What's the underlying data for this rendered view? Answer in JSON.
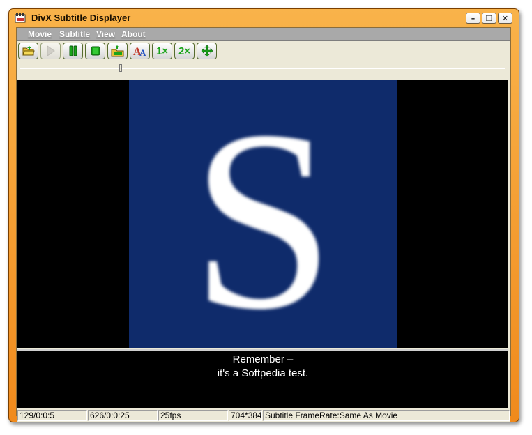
{
  "window": {
    "title": "DivX Subtitle Displayer",
    "controls": {
      "minimize": "–",
      "restore": "❐",
      "close": "✕"
    }
  },
  "menu": [
    "Movie",
    "Subtitle",
    "View",
    "About"
  ],
  "toolbar": {
    "buttons": [
      {
        "icon": "open-folder-icon"
      },
      {
        "icon": "play-icon",
        "disabled": true
      },
      {
        "icon": "pause-icon"
      },
      {
        "icon": "stop-icon"
      },
      {
        "icon": "load-subtitle-icon"
      },
      {
        "icon": "font-icon"
      },
      {
        "label": "1×",
        "icon": "zoom-1x-icon"
      },
      {
        "label": "2×",
        "icon": "zoom-2x-icon"
      },
      {
        "icon": "fullscreen-move-icon"
      }
    ]
  },
  "seek": {
    "progress": 0.206
  },
  "video": {
    "logo_letter": "S",
    "bg": "#0f2b6b"
  },
  "subtitle": {
    "lines": [
      "Remember –",
      "it's a Softpedia test."
    ]
  },
  "status": {
    "frames": "129/0:0:5",
    "total": "626/0:0:25",
    "fps": "25fps",
    "resolution": "704*384",
    "subtitle_rate": "Subtitle FrameRate:Same As Movie"
  },
  "colors": {
    "accent": "#f49a28",
    "button_green": "#1aa31a"
  }
}
